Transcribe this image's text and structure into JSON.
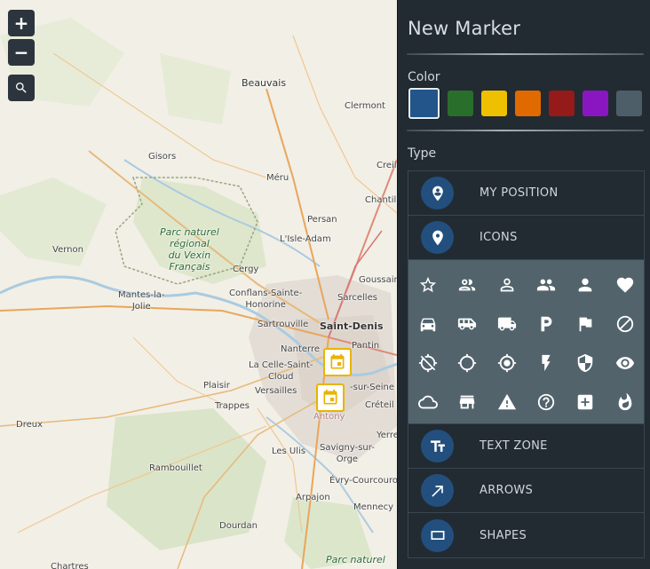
{
  "map": {
    "zoom_in_label": "+",
    "zoom_out_label": "−",
    "labels": {
      "beauvais": "Beauvais",
      "clermont": "Clermont",
      "gisors": "Gisors",
      "creil": "Creil",
      "meru": "Méru",
      "chantilly": "Chantill",
      "persan": "Persan",
      "park": "Parc naturel\nrégional\ndu Vexin\nFrançais",
      "lisle_adam": "L'Isle-Adam",
      "vernon": "Vernon",
      "cergy": "Cergy",
      "goussainville": "Goussain",
      "mantes": "Mantes-la-\nJolie",
      "conflans": "Conflans-Sainte-\nHonorine",
      "sarcelles": "Sarcelles",
      "saint_denis": "Saint-Denis",
      "sartrouville": "Sartrouville",
      "nanterre": "Nanterre",
      "pantin": "Pantin",
      "la_celle": "La Celle-Saint-\nCloud",
      "plaisir": "Plaisir",
      "versailles": "Versailles",
      "seur": "-sur-Seine",
      "trappes": "Trappes",
      "creteil": "Créteil",
      "antony": "Antony",
      "dreux": "Dreux",
      "yerres": "Yerres",
      "les_ulis": "Les Ulis",
      "savigny": "Savigny-sur-\nOrge",
      "rambouillet": "Rambouillet",
      "evry": "Évry-Courcouron",
      "arpajon": "Arpajon",
      "mennecy": "Mennecy",
      "dourdan": "Dourdan",
      "chartres": "Chartres",
      "park_south": "Parc naturel"
    },
    "markers": [
      {
        "name": "event-marker-1",
        "icon": "calendar-icon"
      },
      {
        "name": "event-marker-2",
        "icon": "calendar-icon"
      }
    ]
  },
  "panel": {
    "title": "New Marker",
    "color_label": "Color",
    "type_label": "Type",
    "colors": [
      {
        "name": "blue",
        "hex": "#24558a",
        "selected": true
      },
      {
        "name": "green",
        "hex": "#2a6e2c",
        "selected": false
      },
      {
        "name": "yellow",
        "hex": "#eec000",
        "selected": false
      },
      {
        "name": "orange",
        "hex": "#e06a00",
        "selected": false
      },
      {
        "name": "red",
        "hex": "#951a1a",
        "selected": false
      },
      {
        "name": "purple",
        "hex": "#8a16c2",
        "selected": false
      },
      {
        "name": "gray",
        "hex": "#4d5e68",
        "selected": false
      }
    ],
    "types": {
      "my_position": "MY POSITION",
      "icons": "ICONS",
      "text_zone": "TEXT ZONE",
      "arrows": "ARROWS",
      "shapes": "SHAPES"
    },
    "icon_grid": [
      "star-icon",
      "group-icon",
      "person-outline-icon",
      "people-icon",
      "person-icon",
      "heart-icon",
      "car-icon",
      "bus-icon",
      "truck-icon",
      "parking-icon",
      "flag-icon",
      "block-icon",
      "gps-off-icon",
      "gps-not-fixed-icon",
      "gps-fixed-icon",
      "flash-icon",
      "security-icon",
      "eye-icon",
      "cloud-icon",
      "store-icon",
      "warning-icon",
      "help-icon",
      "plus-box-icon",
      "fire-icon"
    ]
  }
}
